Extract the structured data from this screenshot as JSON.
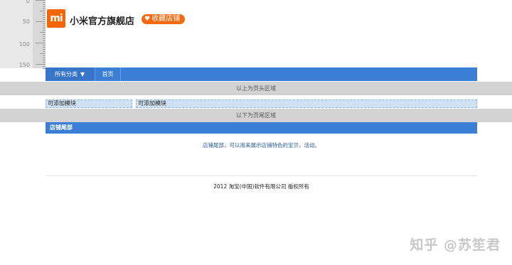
{
  "ruler": {
    "labels": [
      "0",
      "50",
      "100",
      "150"
    ]
  },
  "header": {
    "logo_glyph": "mi",
    "shop_name": "小米官方旗舰店",
    "favorite_label": "收藏店铺",
    "favorite_color": "#f46a13",
    "logo_color": "#f56600"
  },
  "nav": {
    "all_categories": "所有分类",
    "home": "首页",
    "bar_color": "#3a7fd5"
  },
  "bands": {
    "top_label": "以上为页头区域",
    "bottom_label": "以下为页尾区域"
  },
  "modules": {
    "left_label": "可添加模块",
    "right_label": "可添加模块"
  },
  "footer": {
    "title": "店铺尾部",
    "description": "店铺尾部，可以用来展示店铺特色的宝贝，活动。",
    "copyright": "2012 淘宝(中国)软件有限公司 版权所有"
  },
  "watermark": "知乎 @苏笙君"
}
